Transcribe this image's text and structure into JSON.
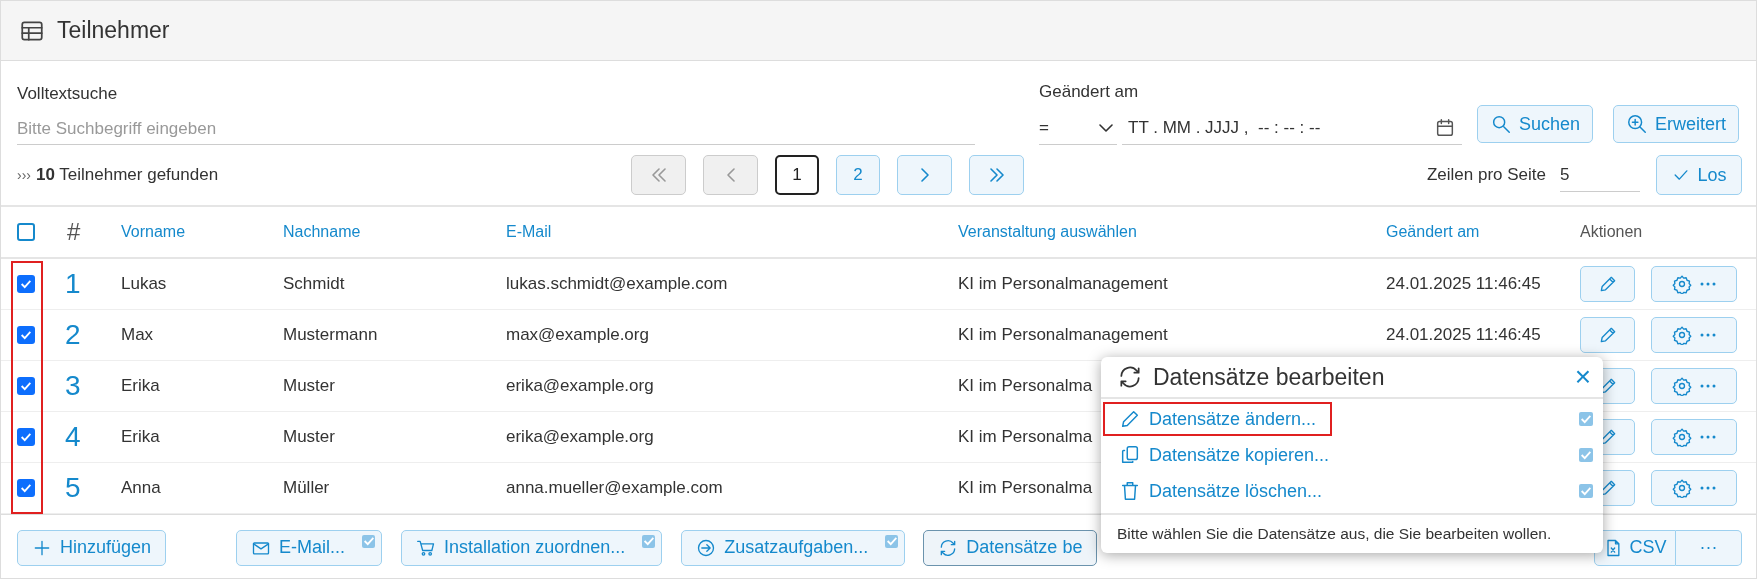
{
  "header": {
    "title": "Teilnehmer"
  },
  "search": {
    "label": "Volltextsuche",
    "placeholder": "Bitte Suchbegriff eingeben"
  },
  "date_filter": {
    "label": "Geändert am",
    "operator": "=",
    "placeholder": "TT . MM . JJJJ ,  -- : -- : --"
  },
  "filter_buttons": [
    {
      "kind": "search",
      "label": "Suchen"
    },
    {
      "kind": "zoom",
      "label": "Erweitert"
    }
  ],
  "results": {
    "marker": "›››",
    "text": "**10** Teilnehmer gefunden"
  },
  "pagination": [
    {
      "kind": "first",
      "disabled": true
    },
    {
      "kind": "prev",
      "disabled": true
    },
    {
      "kind": "page",
      "label": "1",
      "selected": true
    },
    {
      "kind": "page",
      "label": "2",
      "selected": false
    },
    {
      "kind": "next",
      "disabled": false
    },
    {
      "kind": "last",
      "disabled": false
    }
  ],
  "rows_per_page": {
    "label": "Zeilen pro Seite",
    "value": "5",
    "button": "Los"
  },
  "table": {
    "select_all_checked": false,
    "checkbox_column_highlighted": true,
    "columns": [
      "#",
      "Vorname",
      "Nachname",
      "E-Mail",
      "Veranstaltung auswählen",
      "Geändert am",
      "Aktionen"
    ],
    "rows": [
      {
        "checked": true,
        "number": "1",
        "first_name": "Lukas",
        "last_name": "Schmidt",
        "email": "lukas.schmidt@example.com",
        "event": "KI im Personalmanagement",
        "changed": "24.01.2025 11:46:45"
      },
      {
        "checked": true,
        "number": "2",
        "first_name": "Max",
        "last_name": "Mustermann",
        "email": "max@example.org",
        "event": "KI im Personalmanagement",
        "changed": "24.01.2025 11:46:45"
      },
      {
        "checked": true,
        "number": "3",
        "first_name": "Erika",
        "last_name": "Muster",
        "email": "erika@example.org",
        "event": "KI im Personalma"
      },
      {
        "checked": true,
        "number": "4",
        "first_name": "Erika",
        "last_name": "Muster",
        "email": "erika@example.org",
        "event": "KI im Personalma"
      },
      {
        "checked": true,
        "number": "5",
        "first_name": "Anna",
        "last_name": "Müller",
        "email": "anna.mueller@example.com",
        "event": "KI im Personalma"
      }
    ]
  },
  "toolbar": [
    {
      "kind": "plus",
      "label": "Hinzufügen",
      "badge": false,
      "active": false
    },
    {
      "kind": "mail",
      "label": "E-Mail...",
      "badge": true,
      "active": false
    },
    {
      "kind": "cart",
      "label": "Installation zuordnen...",
      "badge": true,
      "active": false
    },
    {
      "kind": "arrow",
      "label": "Zusatzaufgaben...",
      "badge": true,
      "active": false
    },
    {
      "kind": "refresh",
      "label": "Datensätze be",
      "badge": false,
      "active": true
    }
  ],
  "export_buttons": [
    {
      "kind": "csv",
      "label": "CSV"
    },
    {
      "kind": "more",
      "label": "···"
    }
  ],
  "popup": {
    "title": "Datensätze bearbeiten",
    "close": "×",
    "items": [
      {
        "kind": "edit",
        "label": "Datensätze ändern...",
        "highlighted": true,
        "checked": true
      },
      {
        "kind": "copy",
        "label": "Datensätze kopieren...",
        "highlighted": false,
        "checked": true
      },
      {
        "kind": "delete",
        "label": "Datensätze löschen...",
        "highlighted": false,
        "checked": true
      }
    ],
    "hint": "Bitte wählen Sie die Datensätze aus, die Sie bearbeiten wollen."
  }
}
